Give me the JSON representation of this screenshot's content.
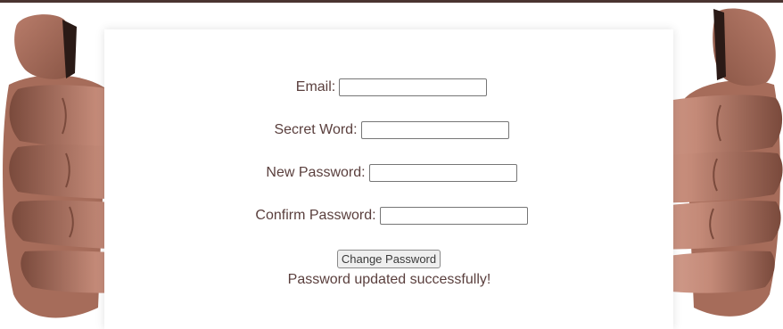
{
  "form": {
    "email_label": "Email:",
    "email_value": "",
    "secret_word_label": "Secret Word:",
    "secret_word_value": "",
    "new_password_label": "New Password:",
    "new_password_value": "",
    "confirm_password_label": "Confirm Password:",
    "confirm_password_value": "",
    "submit_label": "Change Password",
    "status_message": "Password updated successfully!"
  },
  "colors": {
    "top_border": "#4a3430",
    "text": "#5a3f3d",
    "background": "#ffffff",
    "skin": "#c98f7d"
  },
  "decorations": {
    "left_image": "left-hand-holding-card",
    "right_image": "right-hand-holding-card"
  }
}
